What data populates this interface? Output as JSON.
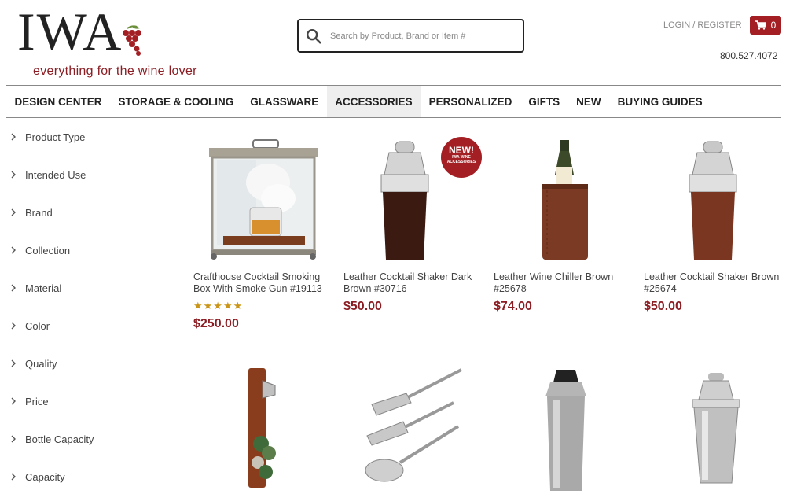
{
  "brand": {
    "logo_text": "IWA",
    "tagline": "everything for the wine lover"
  },
  "search": {
    "placeholder": "Search by Product, Brand or Item #"
  },
  "header": {
    "login": "LOGIN / REGISTER",
    "cart_count": "0",
    "phone": "800.527.4072"
  },
  "nav": [
    {
      "label": "DESIGN CENTER"
    },
    {
      "label": "STORAGE & COOLING"
    },
    {
      "label": "GLASSWARE"
    },
    {
      "label": "ACCESSORIES",
      "active": true
    },
    {
      "label": "PERSONALIZED"
    },
    {
      "label": "GIFTS"
    },
    {
      "label": "NEW"
    },
    {
      "label": "BUYING GUIDES"
    }
  ],
  "filters": [
    {
      "label": "Product Type"
    },
    {
      "label": "Intended Use"
    },
    {
      "label": "Brand"
    },
    {
      "label": "Collection"
    },
    {
      "label": "Material"
    },
    {
      "label": "Color"
    },
    {
      "label": "Quality"
    },
    {
      "label": "Price"
    },
    {
      "label": "Bottle Capacity"
    },
    {
      "label": "Capacity"
    }
  ],
  "products": [
    {
      "name": "Crafthouse Cocktail Smoking Box With Smoke Gun #19113",
      "price": "$250.00",
      "rating": 5,
      "stars": "★★★★★",
      "icon": "smoking-box"
    },
    {
      "name": "Leather Cocktail Shaker Dark Brown #30716",
      "price": "$50.00",
      "badge": "NEW!",
      "badge_sub": "IWA WINE ACCESSORIES",
      "icon": "shaker-dark"
    },
    {
      "name": "Leather Wine Chiller Brown #25678",
      "price": "$74.00",
      "icon": "wine-chiller"
    },
    {
      "name": "Leather Cocktail Shaker Brown #25674",
      "price": "$50.00",
      "icon": "shaker-brown"
    },
    {
      "name": "",
      "price": "",
      "icon": "bottle-opener"
    },
    {
      "name": "",
      "price": "",
      "icon": "absinthe-spoons"
    },
    {
      "name": "",
      "price": "",
      "icon": "steel-shaker"
    },
    {
      "name": "",
      "price": "",
      "icon": "cobbler-shaker"
    }
  ],
  "colors": {
    "brand_red": "#a31f24",
    "price_red": "#8b1d23",
    "star_gold": "#c9961a"
  }
}
